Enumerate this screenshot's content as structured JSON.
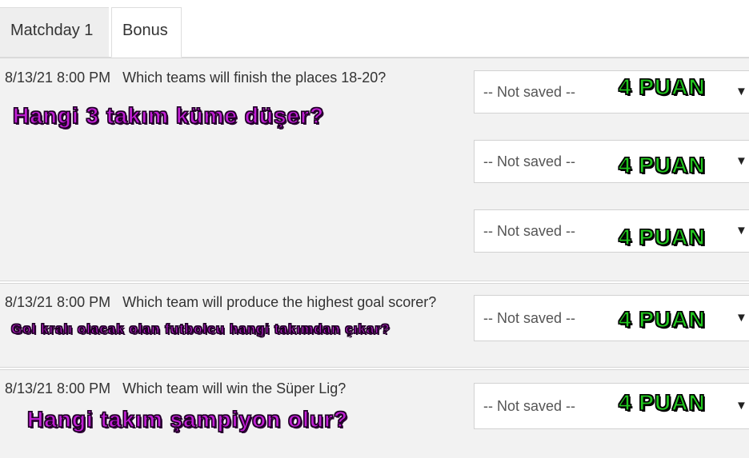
{
  "tabs": [
    {
      "label": "Matchday 1",
      "active": false
    },
    {
      "label": "Bonus",
      "active": true
    }
  ],
  "questions": [
    {
      "datetime": "8/13/21 8:00 PM",
      "question": "Which teams will finish the places 18-20?",
      "note": "Hangi 3 takım küme düşer?",
      "selects": [
        {
          "value": "-- Not saved --",
          "points": "4 PUAN"
        },
        {
          "value": "-- Not saved --",
          "points": "4 PUAN"
        },
        {
          "value": "-- Not saved --",
          "points": "4 PUAN"
        }
      ]
    },
    {
      "datetime": "8/13/21 8:00 PM",
      "question": "Which team will produce the highest goal scorer?",
      "note": "Gol kralı olacak olan futbolcu hangi takımdan çıkar?",
      "selects": [
        {
          "value": "-- Not saved --",
          "points": "4 PUAN"
        }
      ]
    },
    {
      "datetime": "8/13/21 8:00 PM",
      "question": "Which team will win the Süper Lig?",
      "note": "Hangi takım şampiyon olur?",
      "selects": [
        {
          "value": "-- Not saved --",
          "points": "4 PUAN"
        }
      ]
    }
  ],
  "colors": {
    "points_text": "#22c81e",
    "note_text": "#c21fd6",
    "section_bg": "#f2f2f2"
  },
  "icons": {
    "dropdown_caret": "caret-down-icon"
  }
}
